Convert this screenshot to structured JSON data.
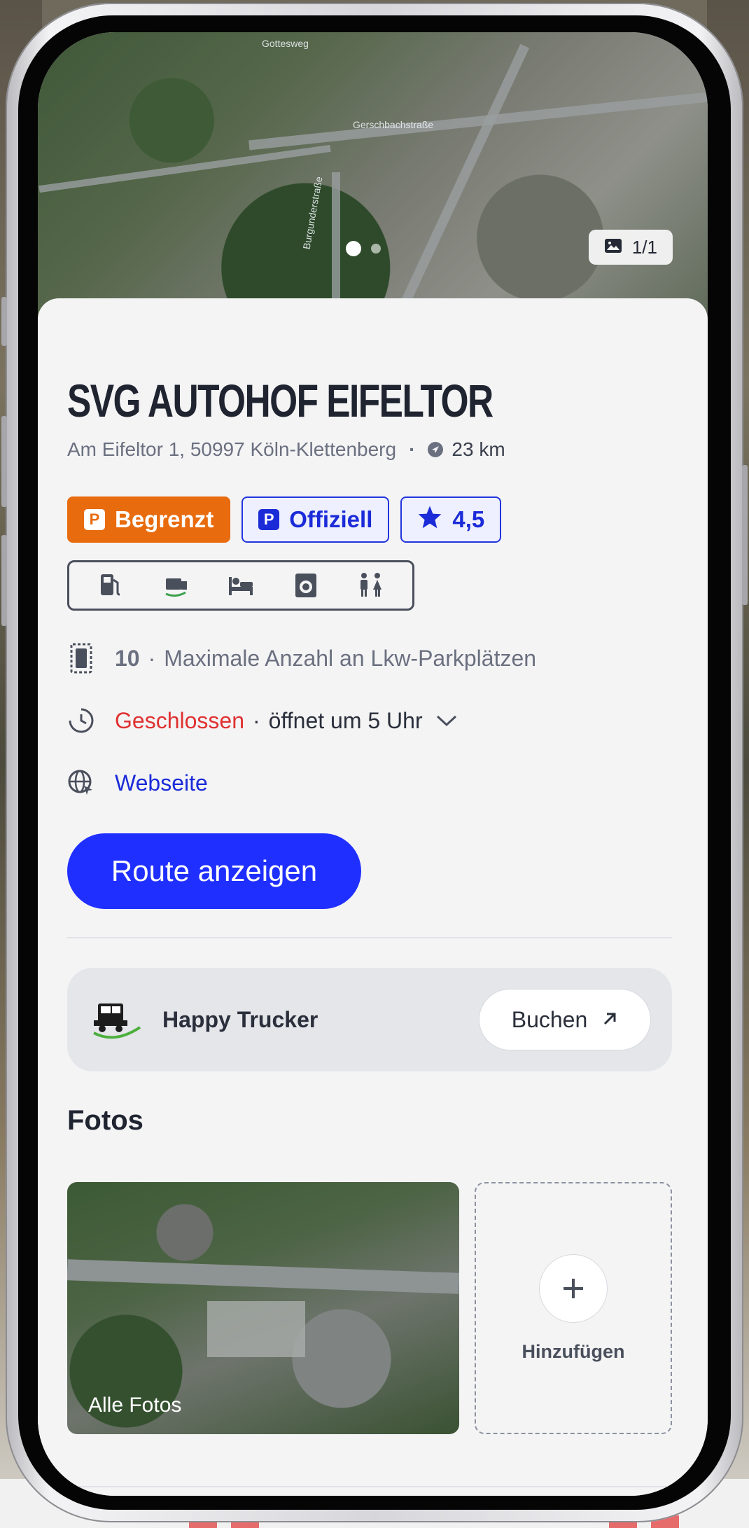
{
  "header": {
    "photo_counter": "1/1",
    "map_labels": {
      "street_top": "Gottesweg",
      "street_middle": "Gerschbachstraße",
      "street_vertical": "Burgunderstraße"
    }
  },
  "place": {
    "name": "SVG AUTOHOF EIFELTOR",
    "address": "Am Eifeltor 1, 50997 Köln-Klettenberg",
    "distance": "23 km"
  },
  "badges": [
    {
      "label": "Begrenzt",
      "icon": "P",
      "style": "orange"
    },
    {
      "label": "Offiziell",
      "icon": "P",
      "style": "blue"
    },
    {
      "label": "4,5",
      "icon": "star-icon",
      "style": "blue"
    }
  ],
  "amenities": [
    "fuel-pump-icon",
    "truck-wash-icon",
    "bed-icon",
    "washing-machine-icon",
    "restroom-icon"
  ],
  "parking": {
    "count": "10",
    "description": "Maximale Anzahl an Lkw-Parkplätzen"
  },
  "hours": {
    "status": "Geschlossen",
    "opens": "öffnet um 5 Uhr"
  },
  "website": {
    "label": "Webseite"
  },
  "route_button": "Route anzeigen",
  "partner": {
    "name": "Happy Trucker",
    "button": "Buchen"
  },
  "photos": {
    "title": "Fotos",
    "all_label": "Alle Fotos",
    "add_label": "Hinzufügen"
  },
  "colors": {
    "accent_blue": "#1f2fff",
    "orange": "#e86b0e",
    "closed_red": "#e03131"
  }
}
